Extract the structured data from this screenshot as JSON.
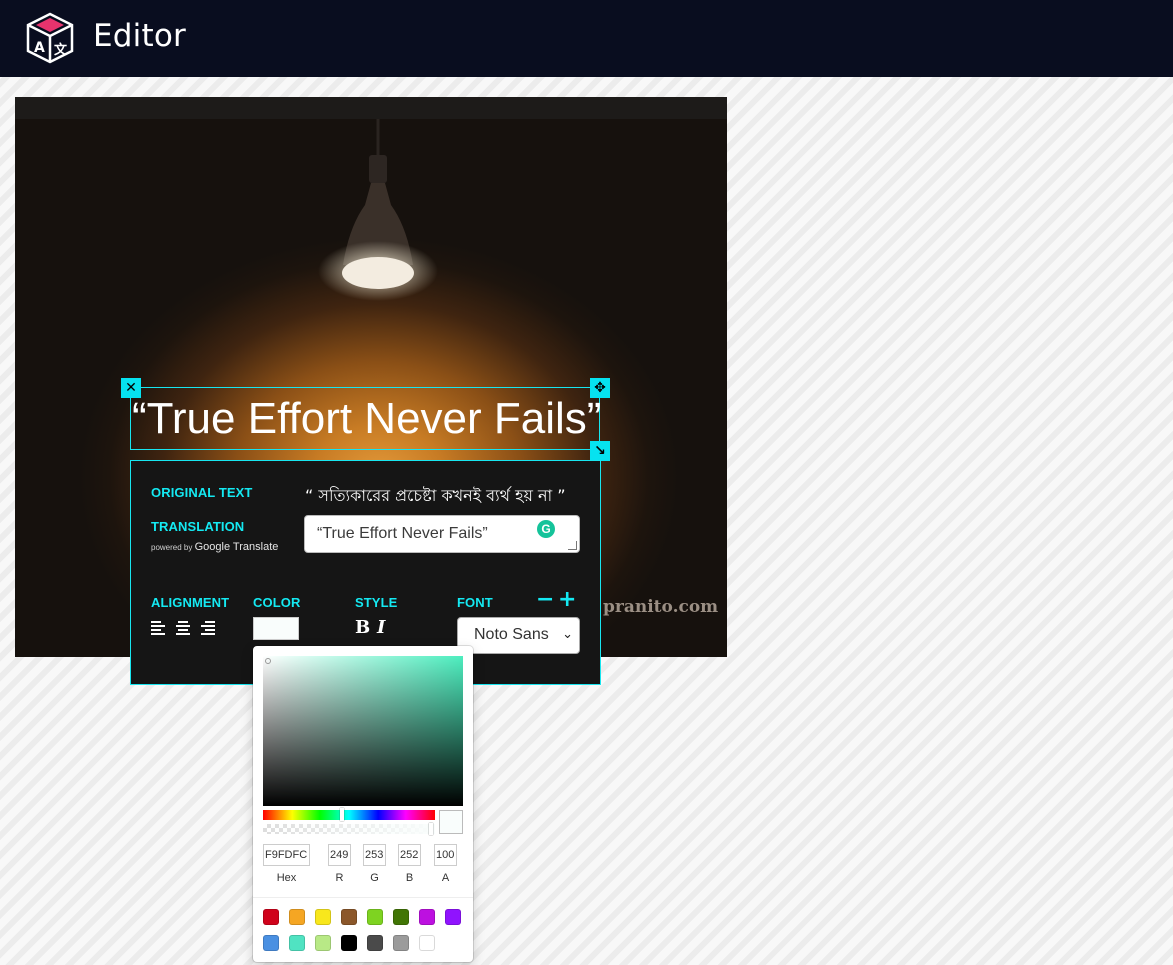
{
  "header": {
    "title": "Editor",
    "logo_icon": "translate-cube-logo"
  },
  "canvas": {
    "overlay_text": "“True Effort Never Fails”",
    "watermark": "pranito.com"
  },
  "panel": {
    "original_label": "ORIGINAL TEXT",
    "original_text": "“ সত্যিকারের প্রচেষ্টা কখনই ব্যর্থ হয় না ”",
    "translation_label": "TRANSLATION",
    "powered_by": "powered by",
    "powered_brand": "Google Translate",
    "translation_value": "“True Effort Never Fails”",
    "alignment_label": "ALIGNMENT",
    "color_label": "COLOR",
    "style_label": "STYLE",
    "font_label": "FONT",
    "bold_label": "B",
    "italic_label": "I",
    "font_minus": "−",
    "font_plus": "+",
    "font_selected": "Noto Sans"
  },
  "color_picker": {
    "hex": "F9FDFC",
    "r": "249",
    "g": "253",
    "b": "252",
    "a": "100",
    "hex_label": "Hex",
    "r_label": "R",
    "g_label": "G",
    "b_label": "B",
    "a_label": "A",
    "presets": [
      "#d0021b",
      "#f5a623",
      "#f8e71c",
      "#8b572a",
      "#7ed321",
      "#417505",
      "#bd10e0",
      "#9013fe",
      "#4a90e2",
      "#50e3c2",
      "#b8e986",
      "#000000",
      "#4a4a4a",
      "#9b9b9b",
      "#ffffff"
    ]
  },
  "colors": {
    "accent": "#14e9f2",
    "topbar": "#090d1f",
    "panel_bg": "#151515"
  }
}
